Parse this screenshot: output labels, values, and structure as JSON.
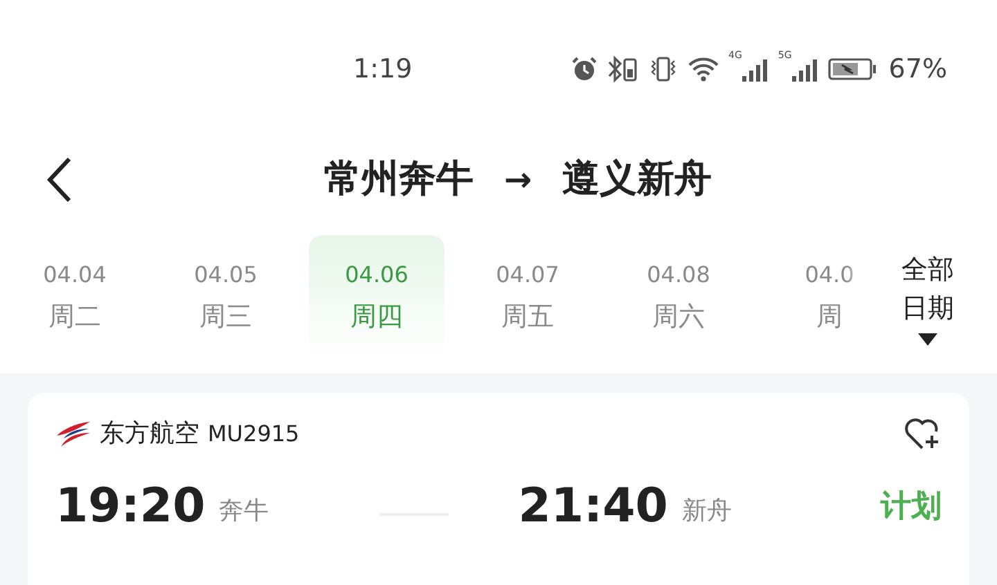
{
  "status_bar": {
    "time": "1:19",
    "network_1": "4G",
    "network_2": "5G",
    "battery": "67%"
  },
  "header": {
    "origin": "常州奔牛",
    "arrow": "→",
    "destination": "遵义新舟"
  },
  "dates": [
    {
      "date": "04.04",
      "weekday": "周二",
      "selected": false
    },
    {
      "date": "04.05",
      "weekday": "周三",
      "selected": false
    },
    {
      "date": "04.06",
      "weekday": "周四",
      "selected": true
    },
    {
      "date": "04.07",
      "weekday": "周五",
      "selected": false
    },
    {
      "date": "04.08",
      "weekday": "周六",
      "selected": false
    },
    {
      "date": "04.0",
      "weekday": "周",
      "selected": false
    }
  ],
  "all_dates": {
    "line_1": "全部",
    "line_2": "日期"
  },
  "flight": {
    "airline": "东方航空",
    "number": "MU2915",
    "departure_time": "19:20",
    "departure_airport": "奔牛",
    "arrival_time": "21:40",
    "arrival_airport": "新舟",
    "status": "计划"
  }
}
